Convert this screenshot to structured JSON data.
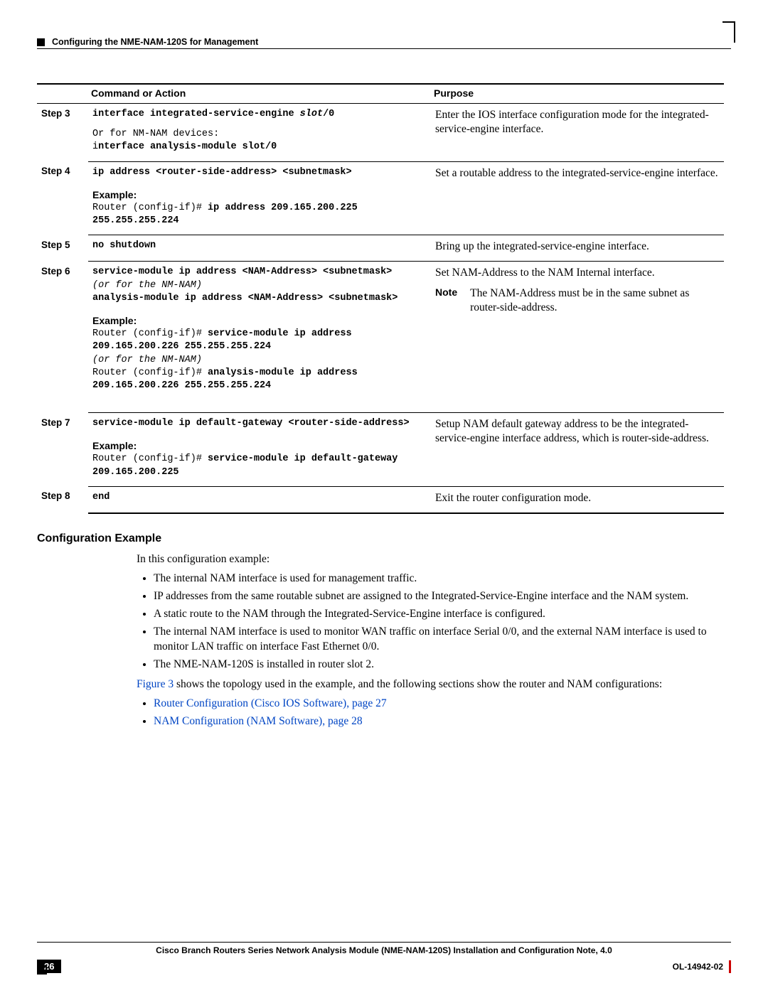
{
  "header": {
    "section_title": "Configuring the NME-NAM-120S for Management"
  },
  "table": {
    "head_command": "Command or Action",
    "head_purpose": "Purpose",
    "example_label": "Example:",
    "note_label": "Note",
    "steps": {
      "s3": {
        "label": "Step 3",
        "cmd_bold_1": "interface integrated-service-engine ",
        "cmd_ital_1": "slot",
        "cmd_bold_1b": "/0",
        "line2": "Or for NM-NAM devices:",
        "line3_pre": "i",
        "line3_bold": "nterface analysis-module slot/0",
        "purpose": "Enter the IOS interface configuration mode for the integrated-service-engine interface."
      },
      "s4": {
        "label": "Step 4",
        "cmd_bold": "ip address <router-side-address> <subnetmask>",
        "ex_pre": "Router (config-if)# ",
        "ex_bold": "ip address 209.165.200.225 255.255.255.224",
        "purpose": "Set a routable address to the integrated-service-engine interface."
      },
      "s5": {
        "label": "Step 5",
        "cmd_bold": "no shutdown",
        "purpose": "Bring up the integrated-service-engine interface."
      },
      "s6": {
        "label": "Step 6",
        "cmd_bold_a": "service-module ip address <NAM-Address> <subnetmask>",
        "cmd_ital_a": "(or for the NM-NAM)",
        "cmd_bold_b": "analysis-module ip address <NAM-Address> <subnetmask>",
        "ex_pre1": "Router (config-if)# ",
        "ex_bold1": "service-module ip address 209.165.200.226 255.255.255.224",
        "ex_ital": "(or for the NM-NAM)",
        "ex_pre2": "Router (config-if)# ",
        "ex_bold2": "analysis-module ip address 209.165.200.226 255.255.255.224",
        "purpose": "Set NAM-Address to the NAM Internal interface.",
        "note_text": "The NAM-Address must be in the same subnet as router-side-address."
      },
      "s7": {
        "label": "Step 7",
        "cmd_bold": "service-module ip default-gateway <router-side-address>",
        "ex_pre": "Router (config-if)# ",
        "ex_bold": "service-module ip default-gateway 209.165.200.225",
        "purpose": "Setup NAM default gateway address to be the integrated-service-engine interface address, which is router-side-address."
      },
      "s8": {
        "label": "Step 8",
        "cmd_bold": "end",
        "purpose": "Exit the router configuration mode."
      }
    }
  },
  "section": {
    "heading": "Configuration Example",
    "intro": "In this configuration example:",
    "bullets": [
      "The internal NAM interface is used for management traffic.",
      "IP addresses from the same routable subnet are assigned to the Integrated-Service-Engine interface and the NAM system.",
      "A static route to the NAM through the Integrated-Service-Engine interface is configured.",
      "The internal NAM interface is used to monitor WAN traffic on interface Serial 0/0, and the external NAM interface is used to monitor LAN traffic on interface Fast Ethernet 0/0.",
      "The NME-NAM-120S is installed in router slot 2."
    ],
    "fig_link": "Figure 3",
    "fig_rest": " shows the topology used in the example, and the following sections show the router and NAM configurations:",
    "link1": "Router Configuration (Cisco IOS Software), page 27",
    "link2": "NAM Configuration (NAM Software), page 28"
  },
  "footer": {
    "title": "Cisco Branch Routers Series Network Analysis Module (NME-NAM-120S) Installation and Configuration Note, 4.0",
    "page": "26",
    "docnum": "OL-14942-02"
  }
}
